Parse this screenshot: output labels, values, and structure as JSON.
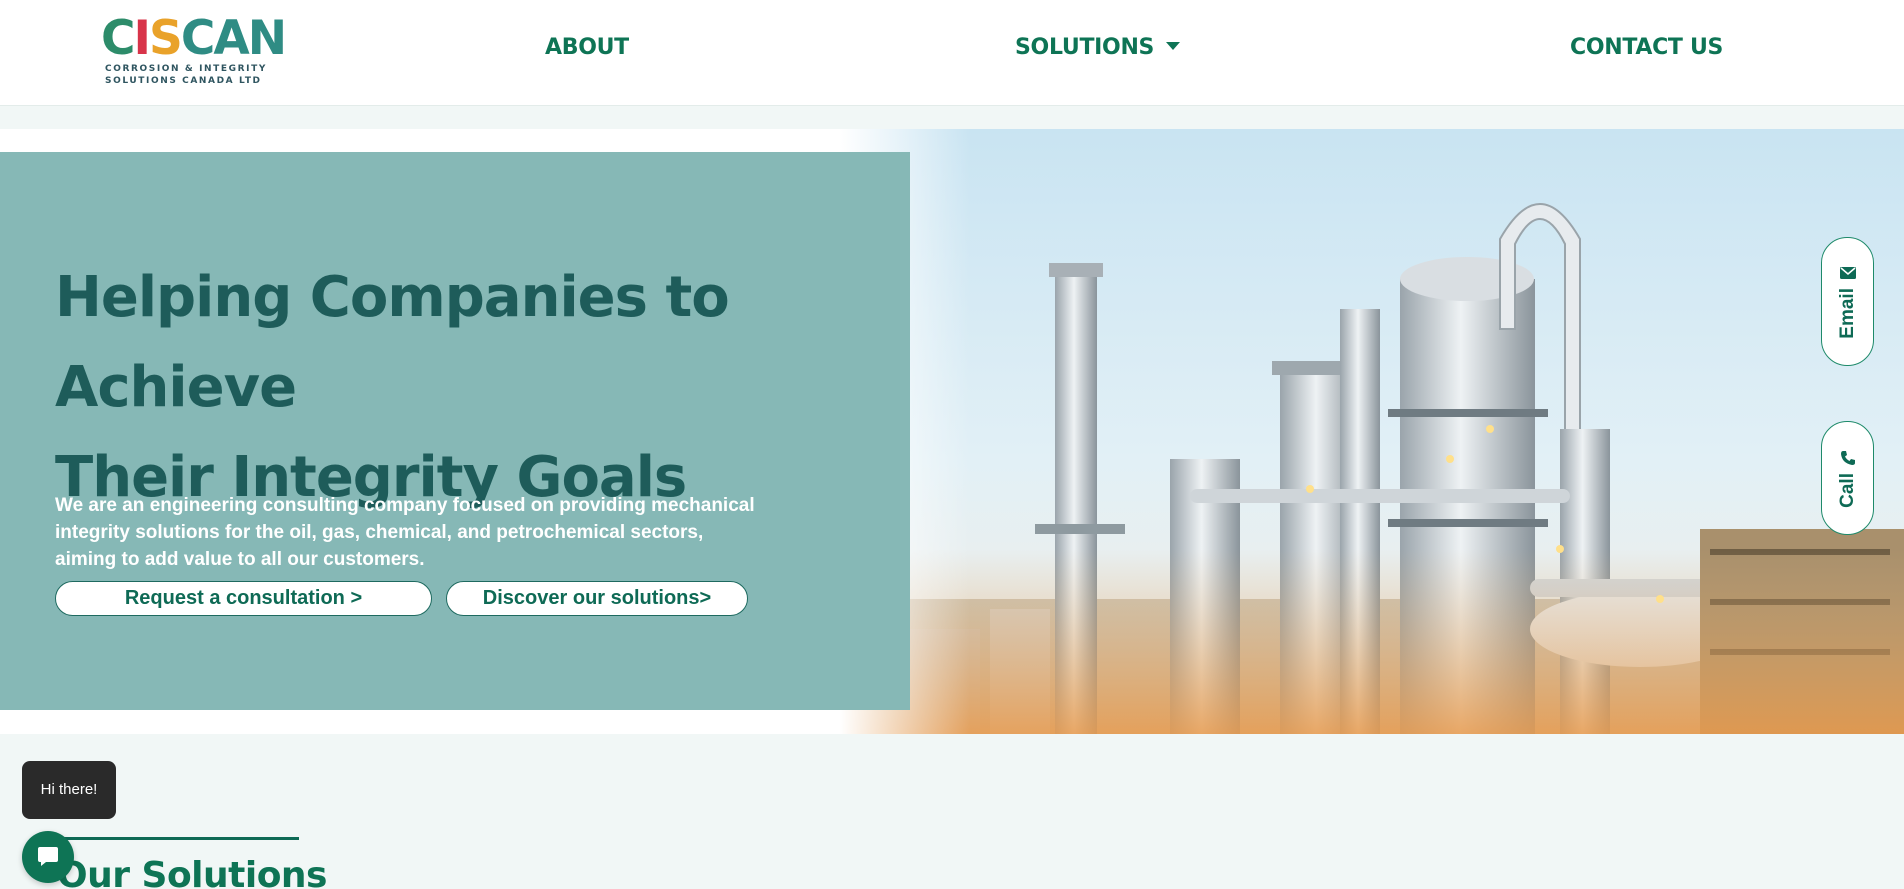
{
  "brand": {
    "mark_parts": [
      "C",
      "I",
      "S",
      "CAN"
    ],
    "subtitle_line1": "CORROSION & INTEGRITY",
    "subtitle_line2": "SOLUTIONS CANADA LTD"
  },
  "nav": {
    "about": "ABOUT",
    "solutions": "SOLUTIONS",
    "contact": "CONTACT US"
  },
  "hero": {
    "title_line1": "Helping Companies to Achieve",
    "title_line2": "Their Integrity Goals",
    "description": "We are an engineering consulting company focused on providing mechanical integrity solutions for the oil, gas, chemical, and petrochemical sectors, aiming to add value to all our customers.",
    "cta_consult": "Request a consultation >",
    "cta_discover": "Discover our solutions>"
  },
  "side_tabs": {
    "email": "Email",
    "call": "Call"
  },
  "solutions_section": {
    "title": "Our Solutions"
  },
  "chat": {
    "greeting": "Hi there!"
  },
  "colors": {
    "brand_green": "#0e7455",
    "hero_panel": "#86b8b6",
    "hero_title": "#1e5c5a",
    "page_bg": "#f1f7f6"
  }
}
